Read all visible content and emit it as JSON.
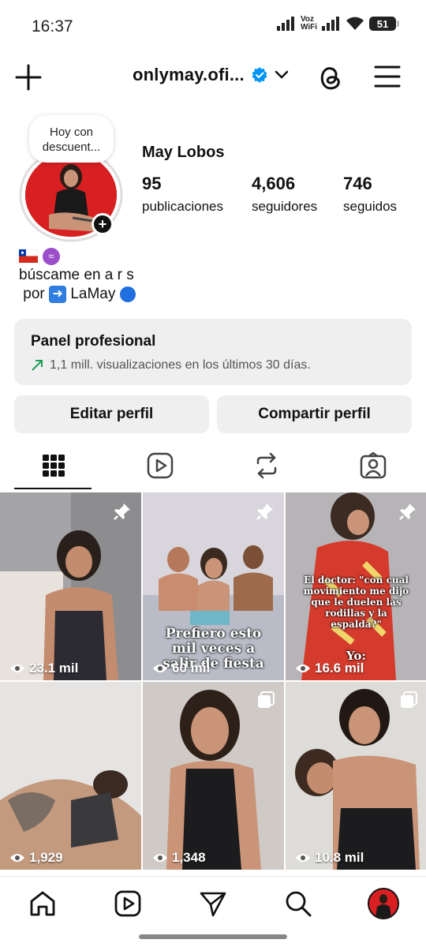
{
  "status_bar": {
    "time": "16:37",
    "voz_wifi_top": "Voz",
    "voz_wifi_bottom": "WiFi",
    "battery": "51"
  },
  "header": {
    "username": "onlymay.ofi...",
    "verified": true
  },
  "profile": {
    "note": "Hoy con descuent...",
    "name": "May Lobos",
    "stats": [
      {
        "value": "95",
        "label": "publicaciones"
      },
      {
        "value": "4,606",
        "label": "seguidores"
      },
      {
        "value": "746",
        "label": "seguidos"
      }
    ],
    "bio_line1": "búscame en a r s",
    "bio_line2_prefix": "por",
    "bio_line2_name": "LaMay"
  },
  "panel": {
    "title": "Panel profesional",
    "subtitle": "1,1 mill. visualizaciones en los últimos 30 días."
  },
  "buttons": {
    "edit": "Editar perfil",
    "share": "Compartir perfil"
  },
  "tabs": [
    "grid-icon",
    "reels-icon",
    "reposts-icon",
    "tagged-icon"
  ],
  "posts": [
    {
      "views": "23.1 mil",
      "pinned": true,
      "caption": ""
    },
    {
      "views": "60 mil",
      "pinned": true,
      "caption": "Prefiero esto mil veces a salir de fiesta"
    },
    {
      "views": "16.6 mil",
      "pinned": true,
      "caption": "El doctor: \"con cual movimiento me dijo que le duelen las rodillas y la espalda?\"",
      "caption_yo": "Yo:"
    },
    {
      "views": "1,929",
      "pinned": false,
      "caption": ""
    },
    {
      "views": "1,348",
      "pinned": false,
      "caption": ""
    },
    {
      "views": "10.8 mil",
      "pinned": false,
      "caption": ""
    }
  ],
  "colors": {
    "accent": "#0095f6",
    "panel_bg": "#efefef",
    "verified": "#0095f6"
  },
  "bottom_nav": [
    "home-icon",
    "reels-icon",
    "send-icon",
    "search-icon",
    "profile-avatar"
  ]
}
